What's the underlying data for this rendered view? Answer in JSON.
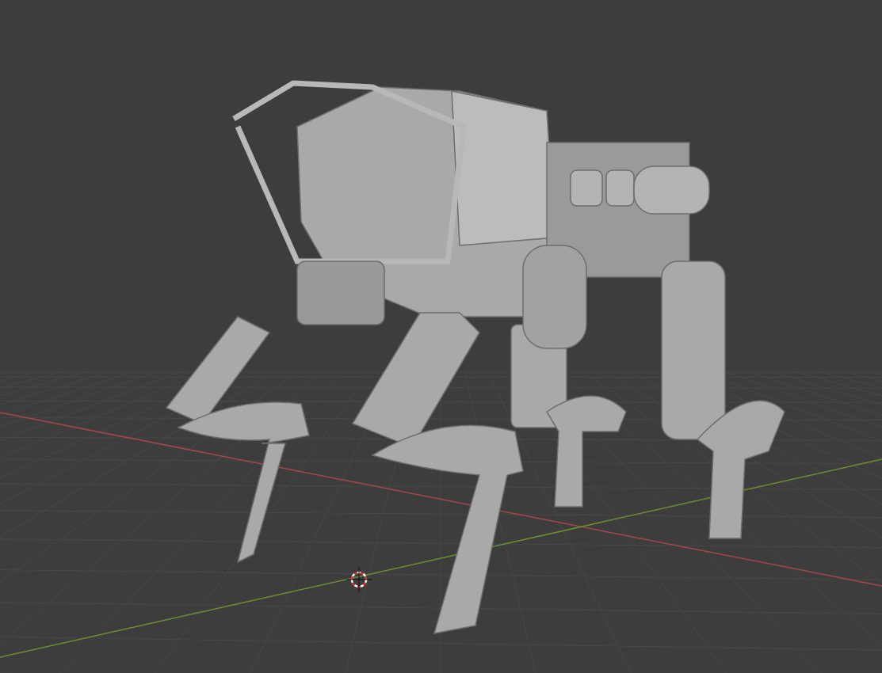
{
  "viewport": {
    "show_floor_grid": true,
    "show_axes": true,
    "show_3d_cursor": true
  }
}
